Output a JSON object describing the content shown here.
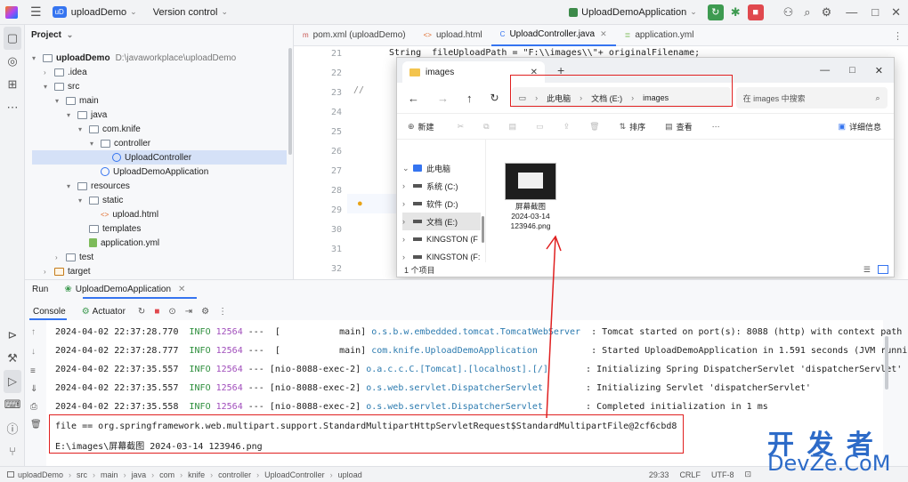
{
  "topbar": {
    "project_badge": "uD",
    "project_name": "uploadDemo",
    "vcs_label": "Version control",
    "run_config": "UploadDemoApplication"
  },
  "project_panel": {
    "title": "Project",
    "tree": [
      {
        "label": "uploadDemo",
        "extra": "D:\\javaworkplace\\uploadDemo",
        "depth": 0,
        "caret": "▾",
        "icon": "folder"
      },
      {
        "label": ".idea",
        "depth": 1,
        "caret": "›",
        "icon": "folder"
      },
      {
        "label": "src",
        "depth": 1,
        "caret": "▾",
        "icon": "folder"
      },
      {
        "label": "main",
        "depth": 2,
        "caret": "▾",
        "icon": "folder"
      },
      {
        "label": "java",
        "depth": 3,
        "caret": "▾",
        "icon": "folder"
      },
      {
        "label": "com.knife",
        "depth": 4,
        "caret": "▾",
        "icon": "folder"
      },
      {
        "label": "controller",
        "depth": 5,
        "caret": "▾",
        "icon": "folder"
      },
      {
        "label": "UploadController",
        "depth": 6,
        "caret": "",
        "icon": "class",
        "selected": true
      },
      {
        "label": "UploadDemoApplication",
        "depth": 5,
        "caret": "",
        "icon": "class"
      },
      {
        "label": "resources",
        "depth": 3,
        "caret": "▾",
        "icon": "folder"
      },
      {
        "label": "static",
        "depth": 4,
        "caret": "▾",
        "icon": "folder"
      },
      {
        "label": "upload.html",
        "depth": 5,
        "caret": "",
        "icon": "html"
      },
      {
        "label": "templates",
        "depth": 4,
        "caret": "",
        "icon": "folder"
      },
      {
        "label": "application.yml",
        "depth": 4,
        "caret": "",
        "icon": "yml"
      },
      {
        "label": "test",
        "depth": 2,
        "caret": "›",
        "icon": "folder"
      },
      {
        "label": "target",
        "depth": 1,
        "caret": "›",
        "icon": "folder-orange"
      }
    ]
  },
  "editor": {
    "tabs": [
      "pom.xml (uploadDemo)",
      "upload.html",
      "UploadController.java",
      "application.yml"
    ],
    "active_tab": 2,
    "lines": [
      "21",
      "22",
      "23",
      "24",
      "25",
      "26",
      "27",
      "28",
      "29",
      "30",
      "31",
      "32"
    ],
    "code_line_21": "String  fileUploadPath = \"F:\\\\images\\\\\"+ originalFilename;",
    "code_line_23": "//"
  },
  "explorer": {
    "tab_title": "images",
    "breadcrumb": [
      "此电脑",
      "文档 (E:)",
      "images"
    ],
    "search_placeholder": "在 images 中搜索",
    "new_label": "新建",
    "sort_label": "排序",
    "view_label": "查看",
    "details_label": "详细信息",
    "sidebar": [
      "此电脑",
      "系统 (C:)",
      "软件 (D:)",
      "文档 (E:)",
      "KINGSTON (F",
      "KINGSTON (F:"
    ],
    "file_name": "屏幕截图\n2024-03-14\n123946.png",
    "status": "1 个项目"
  },
  "run_panel": {
    "run_label": "Run",
    "run_tab": "UploadDemoApplication",
    "console_tab": "Console",
    "actuator_tab": "Actuator",
    "logs": [
      {
        "ts": "2024-04-02 22:37:28.770",
        "level": "INFO",
        "pid": "12564",
        "thread": "---  [           main]",
        "cls": "o.s.b.w.embedded.tomcat.TomcatWebServer ",
        "msg": " : Tomcat started on port(s): 8088 (http) with context path '"
      },
      {
        "ts": "2024-04-02 22:37:28.777",
        "level": "INFO",
        "pid": "12564",
        "thread": "---  [           main]",
        "cls": "com.knife.UploadDemoApplication         ",
        "msg": " : Started UploadDemoApplication in 1.591 seconds (JVM running"
      },
      {
        "ts": "2024-04-02 22:37:35.557",
        "level": "INFO",
        "pid": "12564",
        "thread": "--- [nio-8088-exec-2]",
        "cls": "o.a.c.c.C.[Tomcat].[localhost].[/]      ",
        "msg": " : Initializing Spring DispatcherServlet 'dispatcherServlet'"
      },
      {
        "ts": "2024-04-02 22:37:35.557",
        "level": "INFO",
        "pid": "12564",
        "thread": "--- [nio-8088-exec-2]",
        "cls": "o.s.web.servlet.DispatcherServlet       ",
        "msg": " : Initializing Servlet 'dispatcherServlet'"
      },
      {
        "ts": "2024-04-02 22:37:35.558",
        "level": "INFO",
        "pid": "12564",
        "thread": "--- [nio-8088-exec-2]",
        "cls": "o.s.web.servlet.DispatcherServlet       ",
        "msg": " : Completed initialization in 1 ms"
      }
    ],
    "output_line_1": "file == org.springframework.web.multipart.support.StandardMultipartHttpServletRequest$StandardMultipartFile@2cf6cbd8",
    "output_line_2": "E:\\images\\屏幕截图 2024-03-14 123946.png"
  },
  "status_bar": {
    "breadcrumb": [
      "uploadDemo",
      "src",
      "main",
      "java",
      "com",
      "knife",
      "controller",
      "UploadController",
      "upload"
    ],
    "position": "29:33",
    "line_sep": "CRLF",
    "encoding": "UTF-8"
  },
  "watermark": {
    "line1": "开 发 者",
    "line2": "DevZe.CoM"
  }
}
